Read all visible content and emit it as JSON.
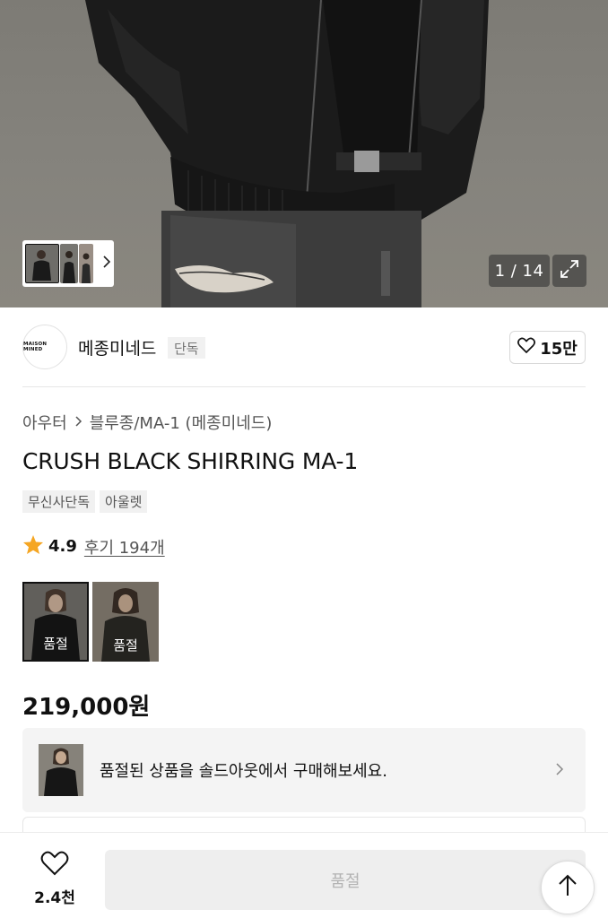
{
  "gallery": {
    "counter": "1 / 14"
  },
  "brand": {
    "logo_text": "MAISON MINED",
    "name": "메종미네드",
    "tag": "단독",
    "likes": "15만"
  },
  "product": {
    "breadcrumb_category": "아우터",
    "breadcrumb_subcategory": "블루종/MA-1 (메종미네드)",
    "title": "CRUSH BLACK SHIRRING MA-1",
    "tags": [
      "무신사단독",
      "아울렛"
    ],
    "rating": "4.9",
    "reviews": "후기 194개",
    "options": [
      {
        "label": "품절",
        "selected": true
      },
      {
        "label": "품절",
        "selected": false
      }
    ],
    "price": "219,000원"
  },
  "soldout_banner": {
    "text": "품절된 상품을 솔드아웃에서 구매해보세요."
  },
  "bottom_bar": {
    "wish_count": "2.4천",
    "buy_label": "품절"
  },
  "colors": {
    "star": "#f5a623",
    "disabled_button_bg": "#eeeeee",
    "disabled_button_text": "#b3b3b3"
  }
}
